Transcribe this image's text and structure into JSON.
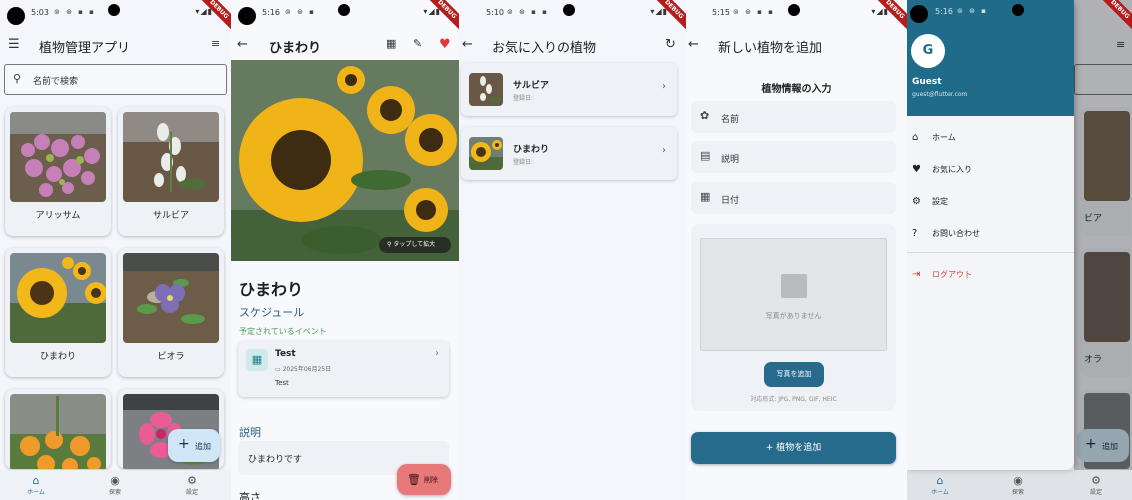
{
  "status": {
    "screen1_time": "5:03",
    "screen2_time": "5:16",
    "screen3_time": "5:10",
    "screen4_time": "5:15",
    "screen5_time": "5:16",
    "debug_label": "DEBUG"
  },
  "screen1": {
    "title": "植物管理アプリ",
    "search_placeholder": "名前で検索",
    "plants": [
      {
        "name": "アリッサム"
      },
      {
        "name": "サルビア"
      },
      {
        "name": "ひまわり"
      },
      {
        "name": "ビオラ"
      }
    ],
    "fab_label": "追加",
    "nav": [
      {
        "label": "ホーム",
        "icon": "home-icon"
      },
      {
        "label": "探索",
        "icon": "compass-icon"
      },
      {
        "label": "設定",
        "icon": "gear-icon"
      }
    ]
  },
  "screen2": {
    "title": "ひまわり",
    "zoom_hint": "タップして拡大",
    "plant_name": "ひまわり",
    "schedule_heading": "スケジュール",
    "upcoming_label": "予定されているイベント",
    "event": {
      "title": "Test",
      "date": "2025年06月25日",
      "note": "Test"
    },
    "desc_heading": "説明",
    "desc_text": "ひまわりです",
    "height_heading": "高さ",
    "delete_label": "削除"
  },
  "screen3": {
    "title": "お気に入りの植物",
    "favorites": [
      {
        "name": "サルビア",
        "date_label": "登録日:"
      },
      {
        "name": "ひまわり",
        "date_label": "登録日:"
      }
    ]
  },
  "screen4": {
    "title": "新しい植物を追加",
    "form_title": "植物情報の入力",
    "fields": {
      "name": "名前",
      "description": "説明",
      "date": "日付"
    },
    "no_photo": "写真がありません",
    "add_photo": "写真を追加",
    "formats": "対応形式: JPG, PNG, GIF, HEIC",
    "submit": "植物を追加"
  },
  "screen5": {
    "avatar_letter": "G",
    "user_name": "Guest",
    "user_email": "guest@flutter.com",
    "menu": [
      {
        "label": "ホーム",
        "icon": "home-icon"
      },
      {
        "label": "お気に入り",
        "icon": "heart-icon"
      },
      {
        "label": "設定",
        "icon": "gear-icon"
      },
      {
        "label": "お問い合わせ",
        "icon": "help-icon"
      }
    ],
    "logout": "ログアウト",
    "behind_labels": [
      "ビア",
      "オラ"
    ],
    "fab_label": "追加",
    "nav": [
      {
        "label": "ホーム"
      },
      {
        "label": "探索"
      },
      {
        "label": "設定"
      }
    ]
  },
  "colors": {
    "primary": "#276b8c",
    "drawer_header": "#1f6b8a",
    "favorite_heart": "#e53935",
    "logout": "#d9443b",
    "delete_button": "#e8797a",
    "upcoming_green": "#4a9a56"
  }
}
